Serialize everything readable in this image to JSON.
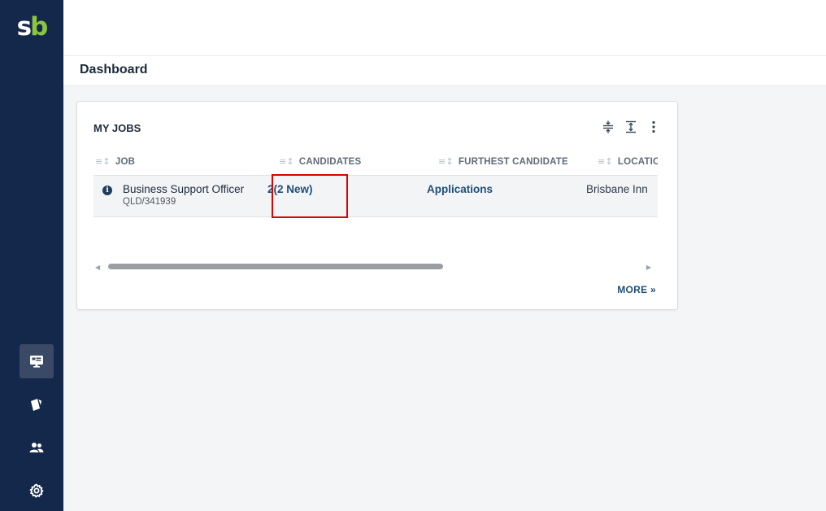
{
  "app": {
    "logo_s": "s",
    "logo_b": "b"
  },
  "sidebar": {
    "items": [
      {
        "icon": "monitor-icon",
        "active": true
      },
      {
        "icon": "cards-icon",
        "active": false
      },
      {
        "icon": "people-icon",
        "active": false
      },
      {
        "icon": "gear-icon",
        "active": false
      }
    ]
  },
  "page": {
    "title": "Dashboard"
  },
  "my_jobs": {
    "title": "MY JOBS",
    "tools": [
      "collapse-rows-icon",
      "expand-rows-icon",
      "more-vertical-icon"
    ],
    "columns": [
      {
        "label": "JOB"
      },
      {
        "label": "CANDIDATES"
      },
      {
        "label": "FURTHEST CANDIDATE"
      },
      {
        "label": "LOCATIOI"
      }
    ],
    "rows": [
      {
        "job_title": "Business Support Officer",
        "job_ref": "QLD/341939",
        "candidates": "2(2 New)",
        "furthest_candidate": "Applications",
        "location": "Brisbane Inn"
      }
    ],
    "more_label": "MORE »"
  },
  "colors": {
    "sidebar": "#14284b",
    "brand_green": "#8cc63f",
    "link": "#1f4e79",
    "highlight": "#e00000"
  }
}
